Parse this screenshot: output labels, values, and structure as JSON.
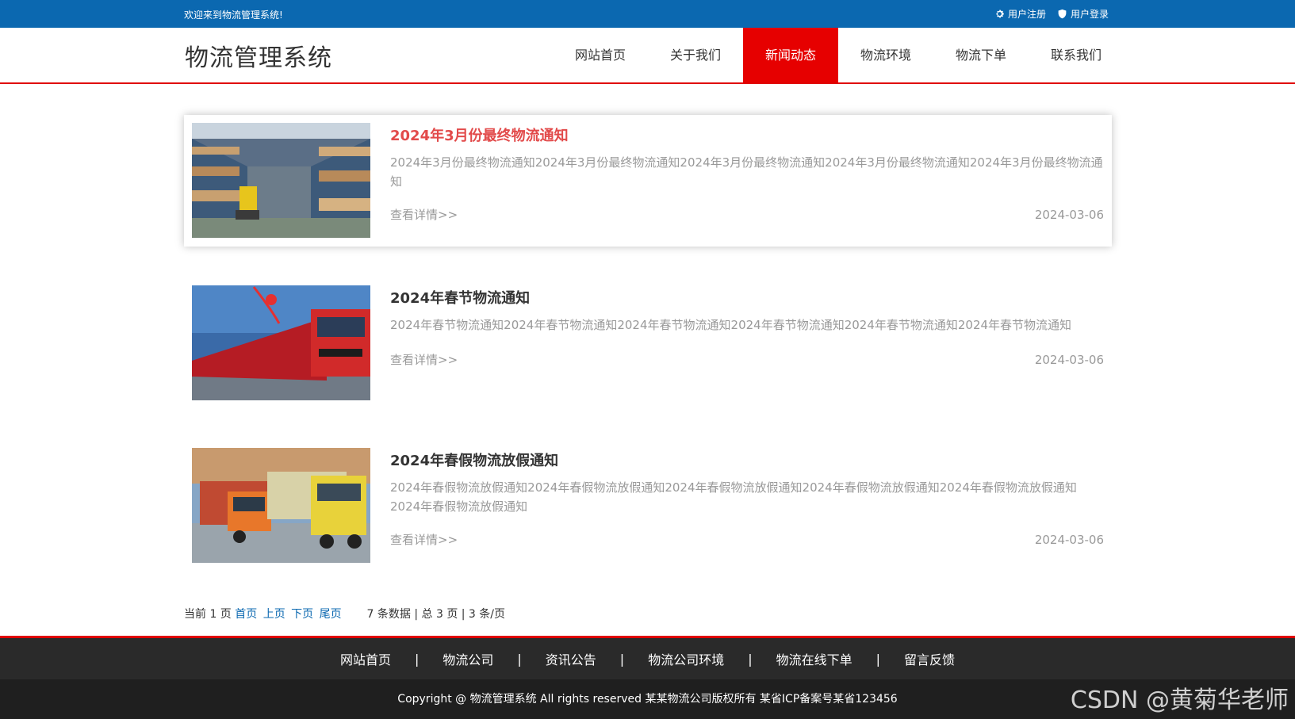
{
  "topbar": {
    "welcome": "欢迎来到物流管理系统!",
    "register": "用户注册",
    "login": "用户登录"
  },
  "header": {
    "logo": "物流管理系统",
    "nav": [
      "网站首页",
      "关于我们",
      "新闻动态",
      "物流环境",
      "物流下单",
      "联系我们"
    ],
    "active_index": 2
  },
  "news": [
    {
      "title": "2024年3月份最终物流通知",
      "desc": "2024年3月份最终物流通知2024年3月份最终物流通知2024年3月份最终物流通知2024年3月份最终物流通知2024年3月份最终物流通知",
      "more": "查看详情>>",
      "date": "2024-03-06"
    },
    {
      "title": "2024年春节物流通知",
      "desc": "2024年春节物流通知2024年春节物流通知2024年春节物流通知2024年春节物流通知2024年春节物流通知2024年春节物流通知",
      "more": "查看详情>>",
      "date": "2024-03-06"
    },
    {
      "title": "2024年春假物流放假通知",
      "desc": "2024年春假物流放假通知2024年春假物流放假通知2024年春假物流放假通知2024年春假物流放假通知2024年春假物流放假通知2024年春假物流放假通知",
      "more": "查看详情>>",
      "date": "2024-03-06"
    }
  ],
  "pager": {
    "current": "当前 1 页",
    "first": "首页",
    "prev": "上页",
    "next": "下页",
    "last": "尾页",
    "summary": "7 条数据 | 总 3 页 | 3 条/页"
  },
  "footer": {
    "links": [
      "网站首页",
      "物流公司",
      "资讯公告",
      "物流公司环境",
      "物流在线下单",
      "留言反馈"
    ],
    "separator": "|",
    "copyright": "Copyright @ 物流管理系统 All rights reserved 某某物流公司版权所有 某省ICP备案号某省123456"
  },
  "watermark": "CSDN @黄菊华老师",
  "colors": {
    "topbar": "#0b68b0",
    "accent_red": "#e60000",
    "highlight_title": "#e24a4a",
    "footer": "#2a2a2a"
  }
}
